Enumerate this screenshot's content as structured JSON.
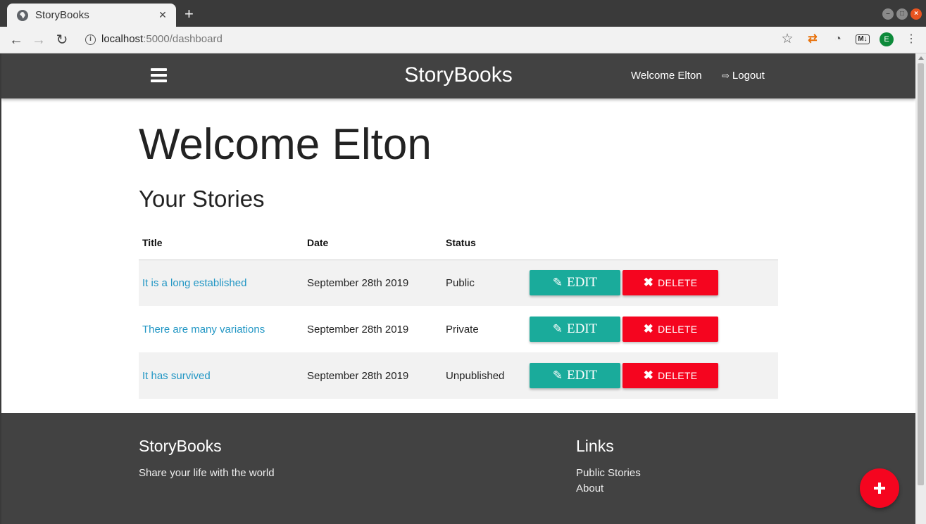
{
  "browser": {
    "tab_title": "StoryBooks",
    "tab_close": "✕",
    "new_tab": "+",
    "url_host": "localhost",
    "url_path": ":5000/dashboard",
    "profile_initial": "E"
  },
  "nav": {
    "brand": "StoryBooks",
    "welcome": "Welcome Elton",
    "logout": "Logout"
  },
  "main": {
    "heading": "Welcome Elton",
    "subheading": "Your Stories"
  },
  "table": {
    "headers": [
      "Title",
      "Date",
      "Status"
    ],
    "rows": [
      {
        "title": "It is a long established",
        "date": "September 28th 2019",
        "status": "Public"
      },
      {
        "title": "There are many variations",
        "date": "September 28th 2019",
        "status": "Private"
      },
      {
        "title": "It has survived",
        "date": "September 28th 2019",
        "status": "Unpublished"
      }
    ],
    "edit_label": "EDIT",
    "delete_label": "DELETE"
  },
  "footer": {
    "brand": "StoryBooks",
    "tagline": "Share your life with the world",
    "links_title": "Links",
    "links": [
      "Public Stories",
      "About"
    ]
  },
  "colors": {
    "nav_bg": "#424242",
    "edit_button": "#1aab9b",
    "delete_button": "#f5051f",
    "link": "#2196c4",
    "fab": "#f5051f"
  }
}
